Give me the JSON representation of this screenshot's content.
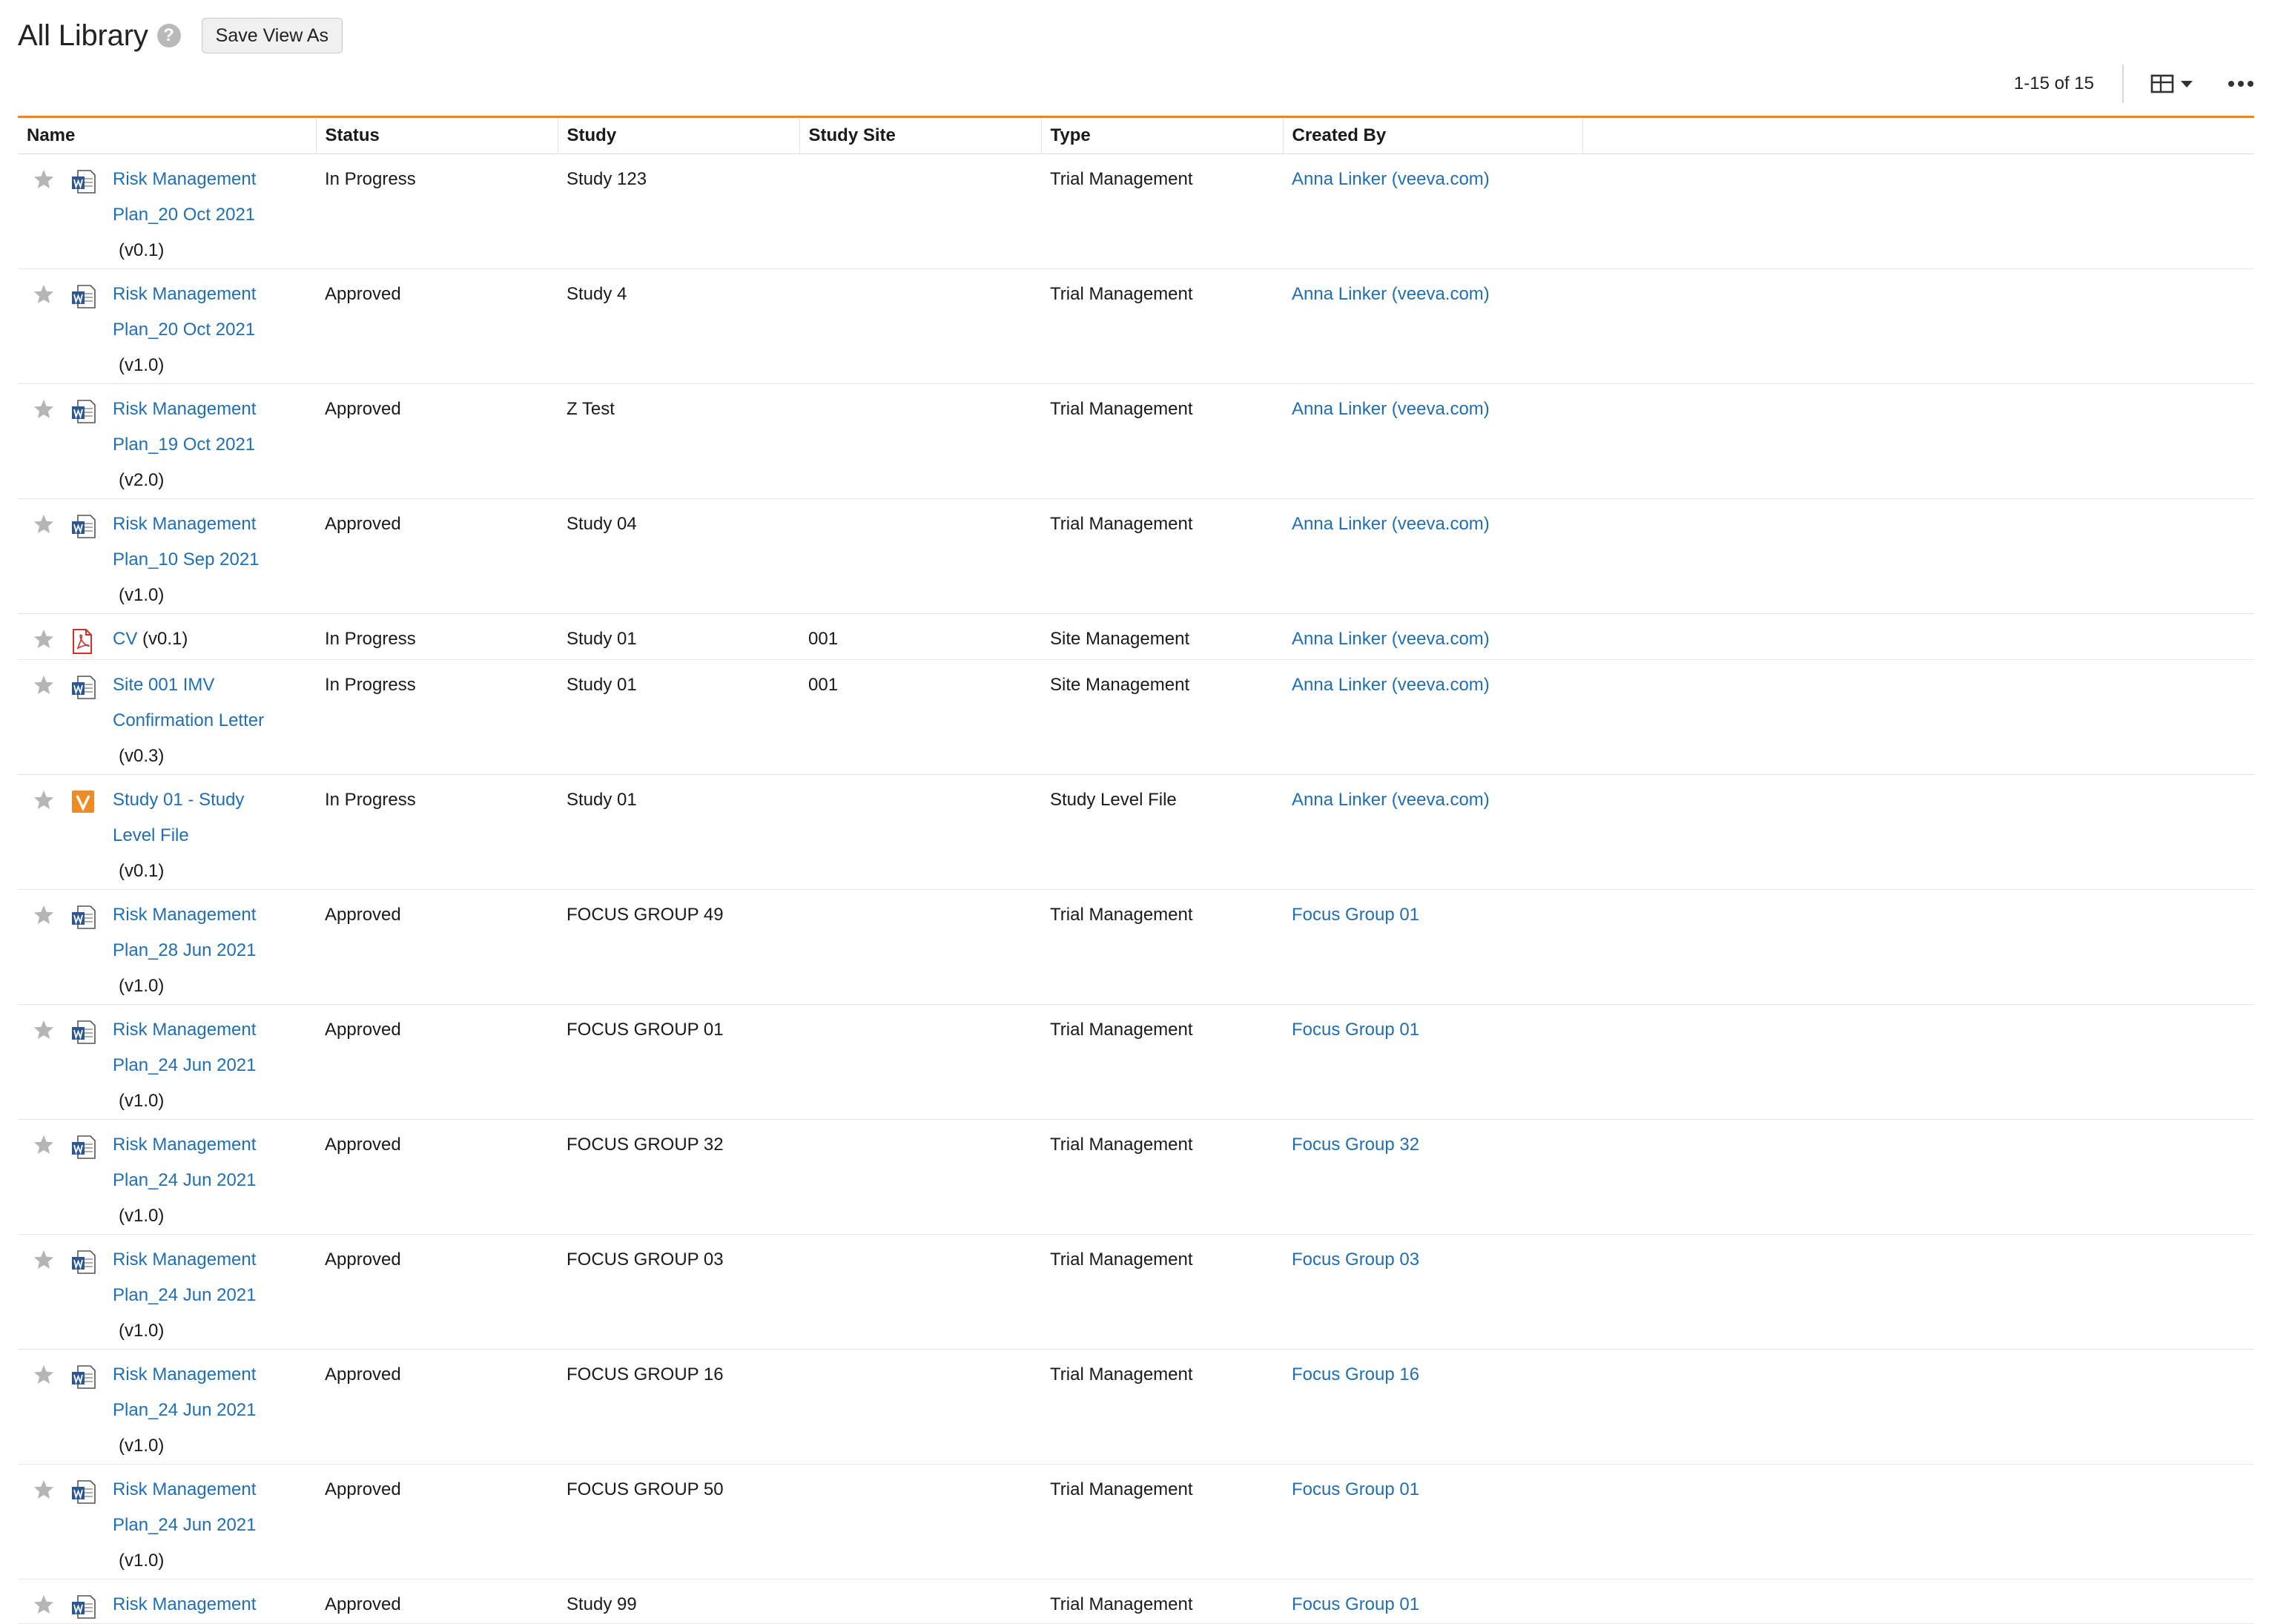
{
  "header": {
    "title": "All Library",
    "save_view_label": "Save View As"
  },
  "toolbar": {
    "pagination": "1-15 of 15"
  },
  "columns": {
    "name": "Name",
    "status": "Status",
    "study": "Study",
    "study_site": "Study Site",
    "type": "Type",
    "created_by": "Created By"
  },
  "rows": [
    {
      "name_line1": "Risk Management",
      "name_line2": "Plan_20 Oct 2021",
      "version": "(v0.1)",
      "status": "In Progress",
      "study": "Study 123",
      "study_site": "",
      "type": "Trial Management",
      "created_by": "Anna Linker (veeva.com)",
      "icon": "word-doc-icon"
    },
    {
      "name_line1": "Risk Management",
      "name_line2": "Plan_20 Oct 2021",
      "version": "(v1.0)",
      "status": "Approved",
      "study": "Study 4",
      "study_site": "",
      "type": "Trial Management",
      "created_by": "Anna Linker (veeva.com)",
      "icon": "word-doc-icon"
    },
    {
      "name_line1": "Risk Management",
      "name_line2": "Plan_19 Oct 2021",
      "version": "(v2.0)",
      "status": "Approved",
      "study": "Z Test",
      "study_site": "",
      "type": "Trial Management",
      "created_by": "Anna Linker (veeva.com)",
      "icon": "word-doc-icon"
    },
    {
      "name_line1": "Risk Management",
      "name_line2": "Plan_10 Sep 2021",
      "version": "(v1.0)",
      "status": "Approved",
      "study": "Study 04",
      "study_site": "",
      "type": "Trial Management",
      "created_by": "Anna Linker (veeva.com)",
      "icon": "word-doc-icon"
    },
    {
      "name_line1": "CV",
      "name_line2": "",
      "version": "(v0.1)",
      "status": "In Progress",
      "study": "Study 01",
      "study_site": "001",
      "type": "Site Management",
      "created_by": "Anna Linker (veeva.com)",
      "icon": "pdf-icon"
    },
    {
      "name_line1": "Site 001 IMV",
      "name_line2": "Confirmation Letter",
      "version": "(v0.3)",
      "status": "In Progress",
      "study": "Study 01",
      "study_site": "001",
      "type": "Site Management",
      "created_by": "Anna Linker (veeva.com)",
      "icon": "word-doc-icon"
    },
    {
      "name_line1": "Study 01 - Study",
      "name_line2": "Level File",
      "version": "(v0.1)",
      "status": "In Progress",
      "study": "Study 01",
      "study_site": "",
      "type": "Study Level File",
      "created_by": "Anna Linker (veeva.com)",
      "icon": "vault-icon"
    },
    {
      "name_line1": "Risk Management",
      "name_line2": "Plan_28 Jun 2021",
      "version": "(v1.0)",
      "status": "Approved",
      "study": "FOCUS GROUP 49",
      "study_site": "",
      "type": "Trial Management",
      "created_by": "Focus Group 01",
      "icon": "word-doc-icon"
    },
    {
      "name_line1": "Risk Management",
      "name_line2": "Plan_24 Jun 2021",
      "version": "(v1.0)",
      "status": "Approved",
      "study": "FOCUS GROUP 01",
      "study_site": "",
      "type": "Trial Management",
      "created_by": "Focus Group 01",
      "icon": "word-doc-icon"
    },
    {
      "name_line1": "Risk Management",
      "name_line2": "Plan_24 Jun 2021",
      "version": "(v1.0)",
      "status": "Approved",
      "study": "FOCUS GROUP 32",
      "study_site": "",
      "type": "Trial Management",
      "created_by": "Focus Group 32",
      "icon": "word-doc-icon"
    },
    {
      "name_line1": "Risk Management",
      "name_line2": "Plan_24 Jun 2021",
      "version": "(v1.0)",
      "status": "Approved",
      "study": "FOCUS GROUP 03",
      "study_site": "",
      "type": "Trial Management",
      "created_by": "Focus Group 03",
      "icon": "word-doc-icon"
    },
    {
      "name_line1": "Risk Management",
      "name_line2": "Plan_24 Jun 2021",
      "version": "(v1.0)",
      "status": "Approved",
      "study": "FOCUS GROUP 16",
      "study_site": "",
      "type": "Trial Management",
      "created_by": "Focus Group 16",
      "icon": "word-doc-icon"
    },
    {
      "name_line1": "Risk Management",
      "name_line2": "Plan_24 Jun 2021",
      "version": "(v1.0)",
      "status": "Approved",
      "study": "FOCUS GROUP 50",
      "study_site": "",
      "type": "Trial Management",
      "created_by": "Focus Group 01",
      "icon": "word-doc-icon"
    },
    {
      "name_line1": "Risk Management",
      "name_line2": "",
      "version": "",
      "status": "Approved",
      "study": "Study 99",
      "study_site": "",
      "type": "Trial Management",
      "created_by": "Focus Group 01",
      "icon": "word-doc-icon"
    }
  ],
  "colors": {
    "link": "#1f6fb2",
    "accent_rule": "#e8862f",
    "star": "#b5b5b5",
    "pdf": "#d0312d",
    "vault": "#f08a24",
    "word": "#2b5797"
  }
}
